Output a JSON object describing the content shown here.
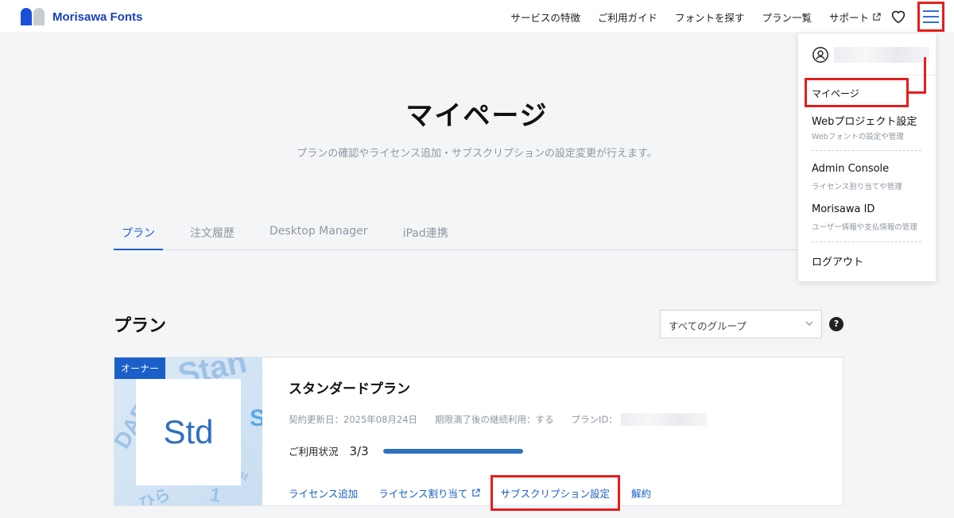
{
  "header": {
    "brand": "Morisawa Fonts",
    "nav": [
      "サービスの特徴",
      "ご利用ガイド",
      "フォントを探す",
      "プラン一覧"
    ],
    "support": "サポート"
  },
  "hero": {
    "title": "マイページ",
    "subtitle": "プランの確認やライセンス追加・サブスクリプションの設定変更が行えます。"
  },
  "tabs": [
    "プラン",
    "注文履歴",
    "Desktop Manager",
    "iPad連携"
  ],
  "plan_section": {
    "title": "プラン",
    "group_select": "すべてのグループ",
    "help": "?"
  },
  "card": {
    "badge": "オーナー",
    "thumb_text": "Std",
    "name": "スタンダードプラン",
    "renewal": "契約更新日：2025年08月24日",
    "continuation": "期限満了後の継続利用：する",
    "plan_id_label": "プランID：",
    "usage_label": "ご利用状況",
    "usage_value": "3/3",
    "usage_fraction": 1.0,
    "actions": {
      "add_license": "ライセンス追加",
      "assign_license": "ライセンス割り当て",
      "subscription": "サブスクリプション設定",
      "cancel": "解約"
    }
  },
  "dropdown": {
    "mypage": "マイページ",
    "web_project": "Webプロジェクト設定",
    "web_project_sub": "Webフォントの設定や管理",
    "admin_console": "Admin Console",
    "admin_console_sub": "ライセンス割り当てや管理",
    "morisawa_id": "Morisawa ID",
    "morisawa_id_sub": "ユーザー情報や支払情報の管理",
    "logout": "ログアウト"
  },
  "colors": {
    "accent": "#1a5fc7",
    "highlight": "#e41e1e",
    "muted": "#8f96a3"
  }
}
